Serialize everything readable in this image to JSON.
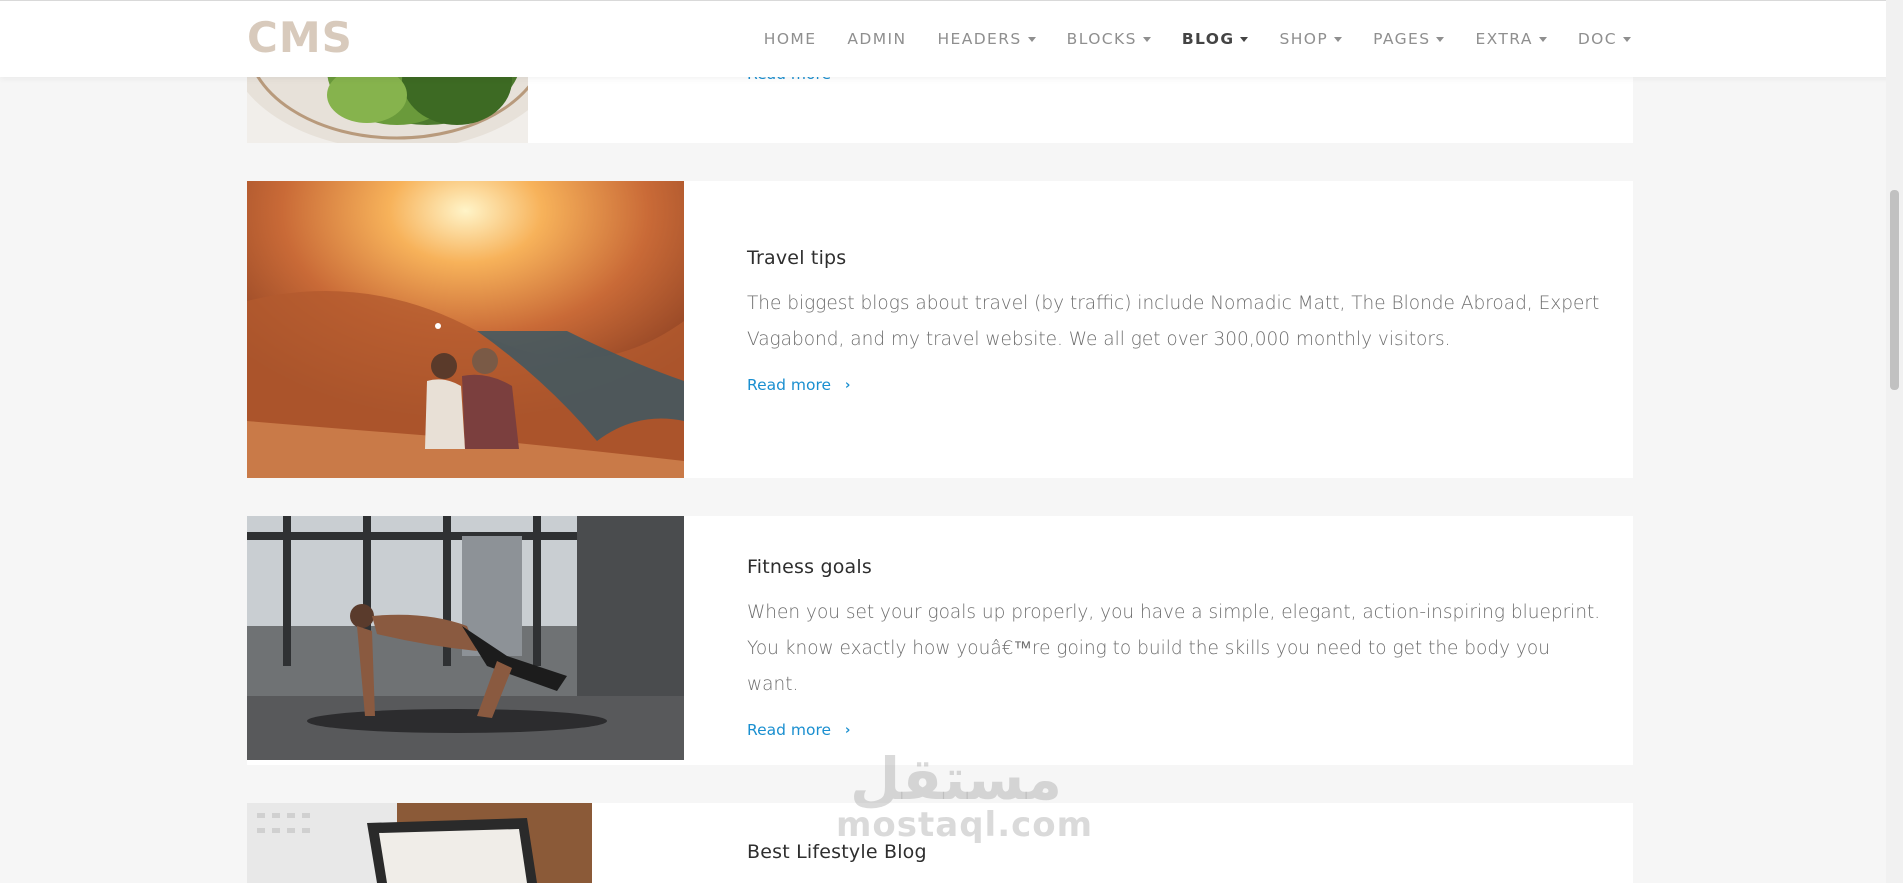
{
  "header": {
    "logo": "CMS",
    "nav": [
      {
        "label": "HOME",
        "dropdown": false,
        "active": false
      },
      {
        "label": "ADMIN",
        "dropdown": false,
        "active": false
      },
      {
        "label": "HEADERS",
        "dropdown": true,
        "active": false
      },
      {
        "label": "BLOCKS",
        "dropdown": true,
        "active": false
      },
      {
        "label": "BLOG",
        "dropdown": true,
        "active": true
      },
      {
        "label": "SHOP",
        "dropdown": true,
        "active": false
      },
      {
        "label": "PAGES",
        "dropdown": true,
        "active": false
      },
      {
        "label": "EXTRA",
        "dropdown": true,
        "active": false
      },
      {
        "label": "DOC",
        "dropdown": true,
        "active": false
      }
    ]
  },
  "posts": [
    {
      "title": "",
      "excerpt": "",
      "read_more": "Read more",
      "image_icon": "salad-photo"
    },
    {
      "title": "Travel tips",
      "excerpt": "The biggest blogs about travel (by traffic) include Nomadic Matt, The Blonde Abroad, Expert Vagabond, and my travel website. We all get over 300,000 monthly visitors.",
      "read_more": "Read more",
      "image_icon": "canyon-couple-photo"
    },
    {
      "title": "Fitness goals",
      "excerpt": "When you set your goals up properly, you have a simple, elegant, action-inspiring blueprint. You know exactly how youâ€™re going to build the skills you need to get the body you want.",
      "read_more": "Read more",
      "image_icon": "workout-photo"
    },
    {
      "title": "Best Lifestyle Blog",
      "excerpt": "",
      "read_more": "",
      "image_icon": "laptop-photo"
    }
  ],
  "watermark": {
    "arabic": "مستقل",
    "latin": "mostaql.com"
  },
  "colors": {
    "accent": "#1a8fd0",
    "logo": "#d8cabc",
    "page_bg": "#f6f6f6"
  }
}
